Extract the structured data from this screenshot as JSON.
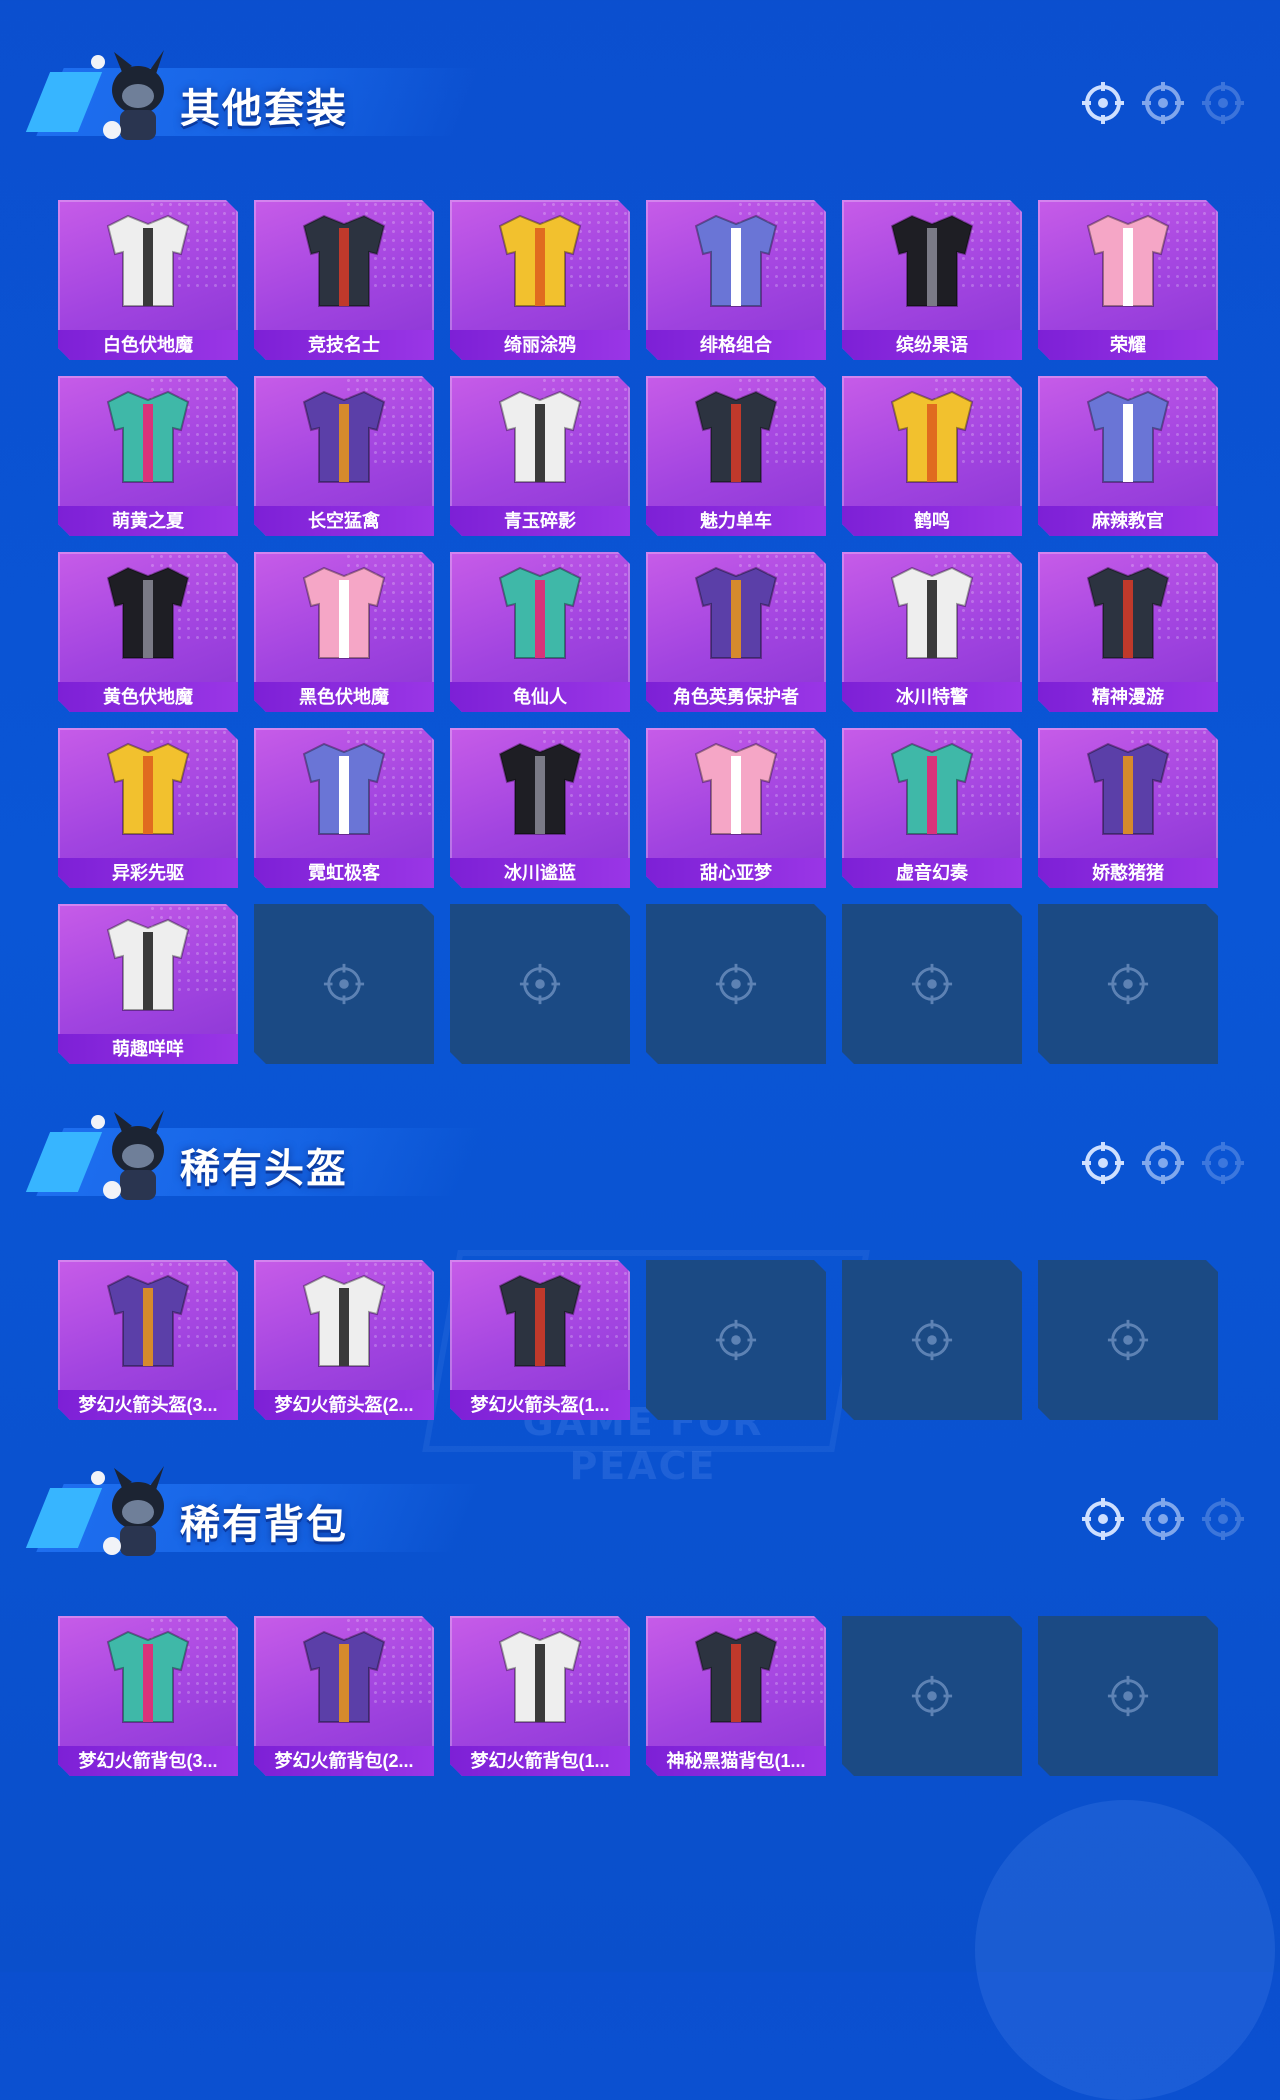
{
  "watermark": "GAME FOR PEACE",
  "sections": [
    {
      "title": "其他套装",
      "items": [
        "白色伏地魔",
        "竞技名士",
        "绮丽涂鸦",
        "绯格组合",
        "缤纷果语",
        "荣耀",
        "萌黄之夏",
        "长空猛禽",
        "青玉碎影",
        "魅力单车",
        "鹤鸣",
        "麻辣教官",
        "黄色伏地魔",
        "黑色伏地魔",
        "龟仙人",
        "角色英勇保护者",
        "冰川特警",
        "精神漫游",
        "异彩先驱",
        "霓虹极客",
        "冰川谧蓝",
        "甜心亚梦",
        "虚音幻奏",
        "娇憨猪猪",
        "萌趣咩咩"
      ],
      "empty_slots": 5
    },
    {
      "title": "稀有头盔",
      "items": [
        "梦幻火箭头盔(3...",
        "梦幻火箭头盔(2...",
        "梦幻火箭头盔(1..."
      ],
      "empty_slots": 3
    },
    {
      "title": "稀有背包",
      "items": [
        "梦幻火箭背包(3...",
        "梦幻火箭背包(2...",
        "梦幻火箭背包(1...",
        "神秘黑猫背包(1..."
      ],
      "empty_slots": 2
    }
  ],
  "colors": {
    "card": "#a144e0",
    "card_label": "#7d20d6",
    "empty_slot": "#1b4a84",
    "background": "#0a56d6"
  },
  "icons": {
    "empty_slot": "crosshair-icon",
    "section_decoration": "crosshair-icon"
  }
}
